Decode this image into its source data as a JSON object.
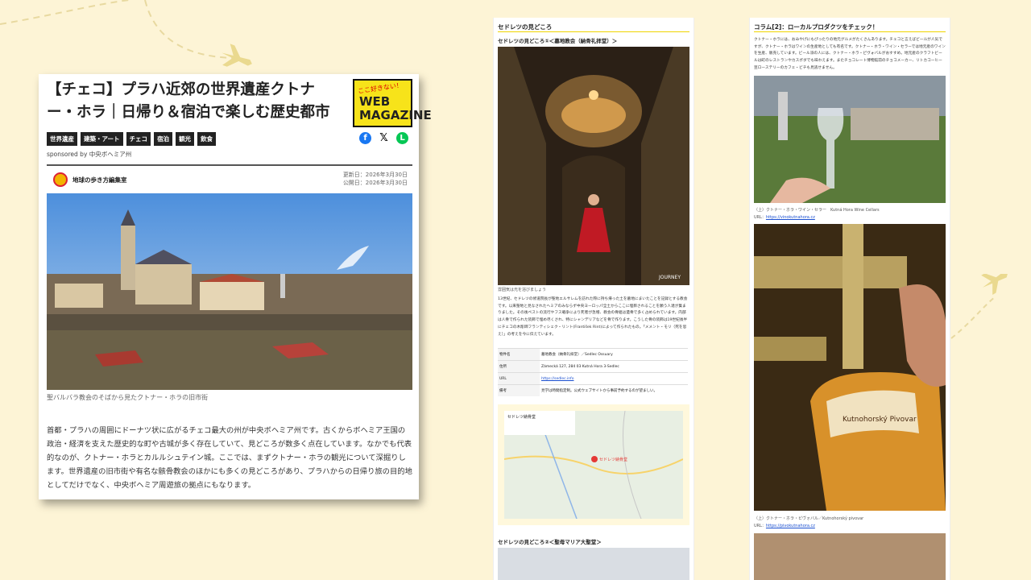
{
  "article": {
    "title": "【チェコ】プラハ近郊の世界遺産クトナー・ホラ｜日帰り＆宿泊で楽しむ歴史都市",
    "logo_top": "ここ好きない！",
    "logo_main": "WEB MAGAZINE",
    "tags": [
      "世界遺産",
      "建築・アート",
      "チェコ",
      "宿泊",
      "観光",
      "飲食"
    ],
    "sponsor": "sponsored by 中央ボヘミア州",
    "author": "地球の歩き方編集室",
    "updated": "更新日：2026年3月30日",
    "published": "公開日：2026年3月30日",
    "hero_caption": "聖バルバラ教会のそばから見たクトナー・ホラの旧市街",
    "body": "首都・プラハの周囲にドーナツ状に広がるチェコ最大の州が中央ボヘミア州です。古くからボヘミア王国の政治・経済を支えた歴史的な町や古城が多く存在していて、見どころが数多く点在しています。なかでも代表的なのが、クトナー・ホラとカルルシュテイン城。ここでは、まずクトナー・ホラの観光について深掘りします。世界遺産の旧市街や有名な骸骨教会のほかにも多くの見どころがあり、プラハからの日帰り旅の目的地としてだけでなく、中央ボヘミア周遊旅の拠点にもなります。"
  },
  "sedlec": {
    "section_title": "セドレツの見どころ",
    "sub1": "セドレツの見どころ①＜墓地教会（納骨礼拝堂）＞",
    "photo_credit": "JOURNEY",
    "photo_caption": "雰囲気は光を浴びましょう",
    "paragraph": "13世紀、セドレツの修道院長が聖地エルサレムを訪れた際に持ち帰った土を墓地にまいたことを記録とする教会です。以来聖地と見なされたヘミアのみならず中央ヨーロッパ全土からここに埋葬されることを願う人達が集まりました。その後ペストの流行やフス戦争により死者が急増、教会の骨組は遺骨で多く占められています。内部は人骨で作られた装飾で埋め尽くされ、特にシャンデリアなどを骨で作ります。こうした骨の装飾は19世紀後半にチェコの木彫師フランティシェク・リント(František Rint)によって作られたもの。「メメント・モリ（死を思え）」の考えを今に伝えています。",
    "table": [
      {
        "k": "物件名",
        "v": "墓地教会（納骨礼拝堂）／Sedlec Ossuary"
      },
      {
        "k": "住所",
        "v": "Zámecká 127, 284 03 Kutná Hora 3-Sedlec"
      },
      {
        "k": "URL",
        "v": "https://sedlec.info"
      },
      {
        "k": "備考",
        "v": "見学は時間指定制。公式ウェブサイトから事前予約するのが望ましい。"
      }
    ],
    "map_place": "セドレツ納骨堂",
    "map_pin": "セドレツ納骨堂",
    "sub2": "セドレツの見どころ②＜聖母マリア大聖堂＞"
  },
  "column": {
    "section_title": "コラム[2]：ローカルプロダクツをチェック！",
    "paragraph": "クトナー・ホラには、おみやげにもぴったりの地元グルメがたくさんあります。チェコと言えばビールが人気ですが、クトナー・ホラはワインの生産地としても有名です。クトナー・ホラ・ワイン・セラーでは地元産のワインを生産、販売しています。ビール派の人には、クトナー・ホラ・ピヴォバルがおすすめ。地元産のクラフトビールは町のレストランやカスポダでも味わえます。またチョコレート博物館前のチョコメーカー、リトカコーヒー豆ローステリーのカフェ・ビチも見逃せません。",
    "caption1": "（上）クトナー・ホラ・ワイン・セラー　Kutná Hora Wine Cellars",
    "url1_label": "URL：",
    "url1": "https://vinokutnahora.cz",
    "caption2": "（上）クトナー・ホラ・ピヴォバル／Kutnohorský pivovar",
    "url2_label": "URL：",
    "url2": "https://pivokutnahora.cz",
    "beer_label": "Kutnohorský Pivovar"
  },
  "colors": {
    "accent": "#f0d400",
    "background": "#fdf4d6"
  }
}
